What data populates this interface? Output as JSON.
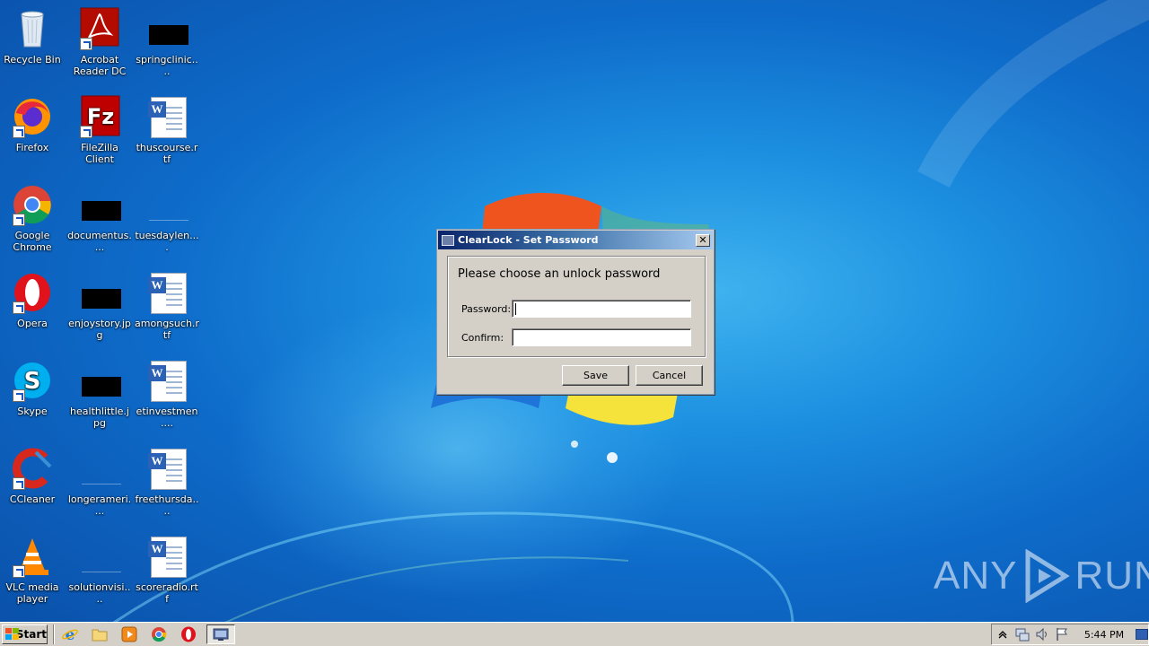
{
  "desktop": {
    "icons": [
      {
        "label": "Recycle Bin",
        "icon": "recycle-bin-icon"
      },
      {
        "label": "Acrobat Reader DC",
        "icon": "acrobat-reader-icon"
      },
      {
        "label": "springclinic....",
        "icon": "image-file-icon"
      },
      {
        "label": "Firefox",
        "icon": "firefox-icon"
      },
      {
        "label": "FileZilla Client",
        "icon": "filezilla-icon"
      },
      {
        "label": "thuscourse.rtf",
        "icon": "word-document-icon"
      },
      {
        "label": "Google Chrome",
        "icon": "chrome-icon"
      },
      {
        "label": "documentus....",
        "icon": "image-file-icon"
      },
      {
        "label": "tuesdaylen....",
        "icon": "image-file-icon"
      },
      {
        "label": "Opera",
        "icon": "opera-icon"
      },
      {
        "label": "enjoystory.jpg",
        "icon": "image-file-icon"
      },
      {
        "label": "amongsuch.rtf",
        "icon": "word-document-icon"
      },
      {
        "label": "Skype",
        "icon": "skype-icon"
      },
      {
        "label": "healthlittle.jpg",
        "icon": "image-file-icon"
      },
      {
        "label": "etinvestmen....",
        "icon": "word-document-icon"
      },
      {
        "label": "CCleaner",
        "icon": "ccleaner-icon"
      },
      {
        "label": "longerameri....",
        "icon": "image-file-icon"
      },
      {
        "label": "freethursda....",
        "icon": "word-document-icon"
      },
      {
        "label": "VLC media player",
        "icon": "vlc-icon"
      },
      {
        "label": "solutionvisi....",
        "icon": "image-file-icon"
      },
      {
        "label": "scoreradio.rtf",
        "icon": "word-document-icon"
      }
    ]
  },
  "dialog": {
    "title": "ClearLock - Set Password",
    "prompt": "Please choose an unlock password",
    "password_label": "Password:",
    "password_value": "",
    "confirm_label": "Confirm:",
    "confirm_value": "",
    "save_label": "Save",
    "cancel_label": "Cancel",
    "close_glyph": "✕"
  },
  "watermark": {
    "left": "ANY",
    "right": "RUN"
  },
  "taskbar": {
    "start_label": "Start",
    "quick_launch": [
      "internet-explorer-icon",
      "folder-icon",
      "media-player-icon",
      "chrome-icon",
      "opera-icon"
    ],
    "active_task": "clearlock-icon",
    "tray": {
      "clock": "5:44 PM",
      "icons": [
        "show-hidden-icons-chevron-icon",
        "network-icon",
        "volume-icon",
        "action-center-flag-icon"
      ]
    }
  },
  "colors": {
    "desktop_bg": "#0e6bc9",
    "dialog_face": "#d4d0c8",
    "title_bar_start": "#0a246a",
    "title_bar_end": "#a6caf0"
  }
}
